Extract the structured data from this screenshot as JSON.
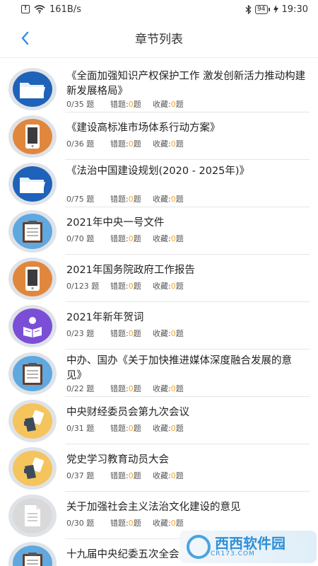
{
  "status_bar": {
    "net_speed": "161B/s",
    "battery": "94",
    "time": "19:30"
  },
  "nav": {
    "title": "章节列表"
  },
  "colors": {
    "accent": "#2a8ee8",
    "zero_count": "#f0a830",
    "icon_blue": "#1f62b9",
    "icon_orange": "#e0873d",
    "icon_lightblue": "#5fa8e0",
    "icon_purple": "#7b4ed6",
    "icon_yellow": "#f5c45c",
    "icon_grey": "#d9d9d9"
  },
  "chapters": [
    {
      "title": "《全面加强知识产权保护工作 激发创新活力推动构建新发展格局》",
      "progress": "0/35 题",
      "wrong_label": "错题:",
      "wrong": "0",
      "wrong_unit": "题",
      "fav_label": "收藏:",
      "fav": "0",
      "fav_unit": "题",
      "icon": "folder-icon"
    },
    {
      "title": "《建设高标准市场体系行动方案》",
      "progress": "0/36 题",
      "wrong_label": "错题:",
      "wrong": "0",
      "wrong_unit": "题",
      "fav_label": "收藏:",
      "fav": "0",
      "fav_unit": "题",
      "icon": "phone-icon"
    },
    {
      "title": "《法治中国建设规划(2020 - 2025年)》",
      "progress": "0/75 题",
      "wrong_label": "错题:",
      "wrong": "0",
      "wrong_unit": "题",
      "fav_label": "收藏:",
      "fav": "0",
      "fav_unit": "题",
      "icon": "folder-icon"
    },
    {
      "title": "2021年中央一号文件",
      "progress": "0/70 题",
      "wrong_label": "错题:",
      "wrong": "0",
      "wrong_unit": "题",
      "fav_label": "收藏:",
      "fav": "0",
      "fav_unit": "题",
      "icon": "clipboard-icon"
    },
    {
      "title": "2021年国务院政府工作报告",
      "progress": "0/123 题",
      "wrong_label": "错题:",
      "wrong": "0",
      "wrong_unit": "题",
      "fav_label": "收藏:",
      "fav": "0",
      "fav_unit": "题",
      "icon": "phone-icon"
    },
    {
      "title": "2021年新年贺词",
      "progress": "0/23 题",
      "wrong_label": "错题:",
      "wrong": "0",
      "wrong_unit": "题",
      "fav_label": "收藏:",
      "fav": "0",
      "fav_unit": "题",
      "icon": "reader-icon"
    },
    {
      "title": "中办、国办《关于加快推进媒体深度融合发展的意见》",
      "progress": "0/22 题",
      "wrong_label": "错题:",
      "wrong": "0",
      "wrong_unit": "题",
      "fav_label": "收藏:",
      "fav": "0",
      "fav_unit": "题",
      "icon": "clipboard-icon"
    },
    {
      "title": "中央财经委员会第九次会议",
      "progress": "0/31 题",
      "wrong_label": "错题:",
      "wrong": "0",
      "wrong_unit": "题",
      "fav_label": "收藏:",
      "fav": "0",
      "fav_unit": "题",
      "icon": "hand-icon"
    },
    {
      "title": "党史学习教育动员大会",
      "progress": "0/37 题",
      "wrong_label": "错题:",
      "wrong": "0",
      "wrong_unit": "题",
      "fav_label": "收藏:",
      "fav": "0",
      "fav_unit": "题",
      "icon": "hand-icon"
    },
    {
      "title": "关于加强社会主义法治文化建设的意见",
      "progress": "0/30 题",
      "wrong_label": "错题:",
      "wrong": "0",
      "wrong_unit": "题",
      "fav_label": "收藏:",
      "fav": "0",
      "fav_unit": "题",
      "icon": "document-icon"
    },
    {
      "title": "十九届中央纪委五次全会公报",
      "icon": "clipboard-icon"
    }
  ],
  "watermark": {
    "name": "西西软件园",
    "site": "CR173.COM"
  }
}
